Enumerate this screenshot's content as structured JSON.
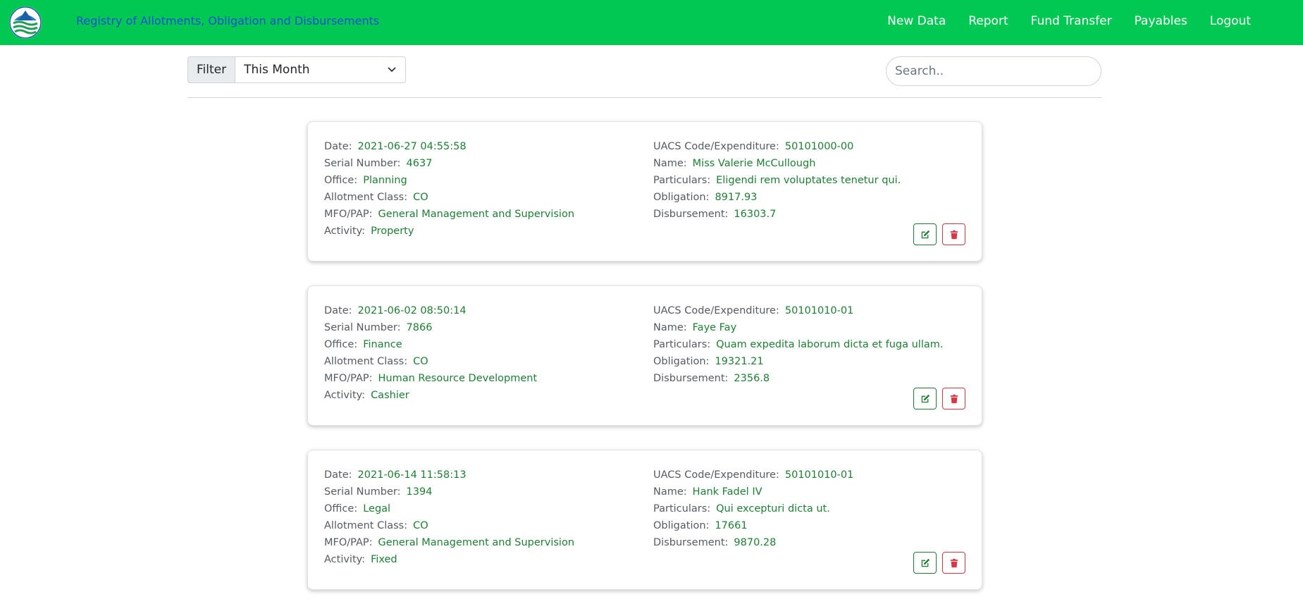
{
  "nav": {
    "brand": "Registry of Allotments, Obligation and Disbursements",
    "links": [
      "New Data",
      "Report",
      "Fund Transfer",
      "Payables",
      "Logout"
    ]
  },
  "filter": {
    "label": "Filter",
    "selected": "This Month"
  },
  "search": {
    "placeholder": "Search.."
  },
  "labels": {
    "date": "Date:",
    "serial": "Serial Number:",
    "office": "Office:",
    "allotment": "Allotment Class:",
    "mfo": "MFO/PAP:",
    "activity": "Activity:",
    "uacs": "UACS Code/Expenditure:",
    "name": "Name:",
    "particulars": "Particulars:",
    "obligation": "Obligation:",
    "disbursement": "Disbursement:"
  },
  "records": [
    {
      "date": "2021-06-27 04:55:58",
      "serial": "4637",
      "office": "Planning",
      "allotment": "CO",
      "mfo": "General Management and Supervision",
      "activity": "Property",
      "uacs": "50101000-00",
      "name": "Miss Valerie McCullough",
      "particulars": "Eligendi rem voluptates tenetur qui.",
      "obligation": "8917.93",
      "disbursement": "16303.7"
    },
    {
      "date": "2021-06-02 08:50:14",
      "serial": "7866",
      "office": "Finance",
      "allotment": "CO",
      "mfo": "Human Resource Development",
      "activity": "Cashier",
      "uacs": "50101010-01",
      "name": "Faye Fay",
      "particulars": "Quam expedita laborum dicta et fuga ullam.",
      "obligation": "19321.21",
      "disbursement": "2356.8"
    },
    {
      "date": "2021-06-14 11:58:13",
      "serial": "1394",
      "office": "Legal",
      "allotment": "CO",
      "mfo": "General Management and Supervision",
      "activity": "Fixed",
      "uacs": "50101010-01",
      "name": "Hank Fadel IV",
      "particulars": "Qui excepturi dicta ut.",
      "obligation": "17661",
      "disbursement": "9870.28"
    }
  ],
  "colors": {
    "navbar": "#00c853",
    "brand_text": "#1d4fd8",
    "value_text": "#1e7e34",
    "delete": "#dc3545"
  }
}
